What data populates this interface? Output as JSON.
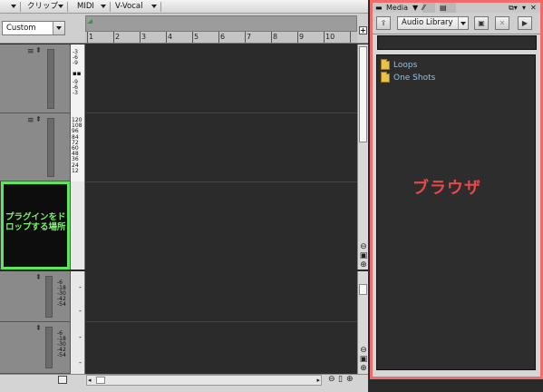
{
  "menubar": {
    "items": [
      {
        "label": ""
      },
      {
        "label": "クリップ"
      },
      {
        "label": "MIDI"
      },
      {
        "label": "V-Vocal"
      }
    ]
  },
  "toolbar": {
    "preset_value": "Custom"
  },
  "ruler": {
    "ticks": [
      "1",
      "2",
      "3",
      "4",
      "5",
      "6",
      "7",
      "8",
      "9",
      "10"
    ]
  },
  "tracks": [
    {
      "meter_labels": [
        "-3",
        "-6",
        "-9",
        "",
        "-9",
        "-6",
        "-3"
      ]
    },
    {
      "meter_labels": [
        "120",
        "108",
        "96",
        "84",
        "72",
        "60",
        "48",
        "36",
        "24",
        "12"
      ]
    },
    {
      "meter_labels": [
        "-6",
        "-18",
        "-30",
        "-42",
        "-54"
      ]
    },
    {
      "meter_labels": [
        "-6",
        "-18",
        "-30",
        "-42",
        "-54"
      ]
    }
  ],
  "drop_zone": {
    "text": "プラグインをドロップする場所"
  },
  "browser": {
    "tabs": {
      "media": "Media"
    },
    "library_select": "Audio Library",
    "folders": [
      "Loops",
      "One Shots"
    ],
    "annotation": "ブラウザ"
  },
  "colors": {
    "annotation_red": "#e84848",
    "drop_zone_green": "#5ee65a",
    "browser_frame": "#f06b6b",
    "folder_text": "#7fc7f0"
  }
}
